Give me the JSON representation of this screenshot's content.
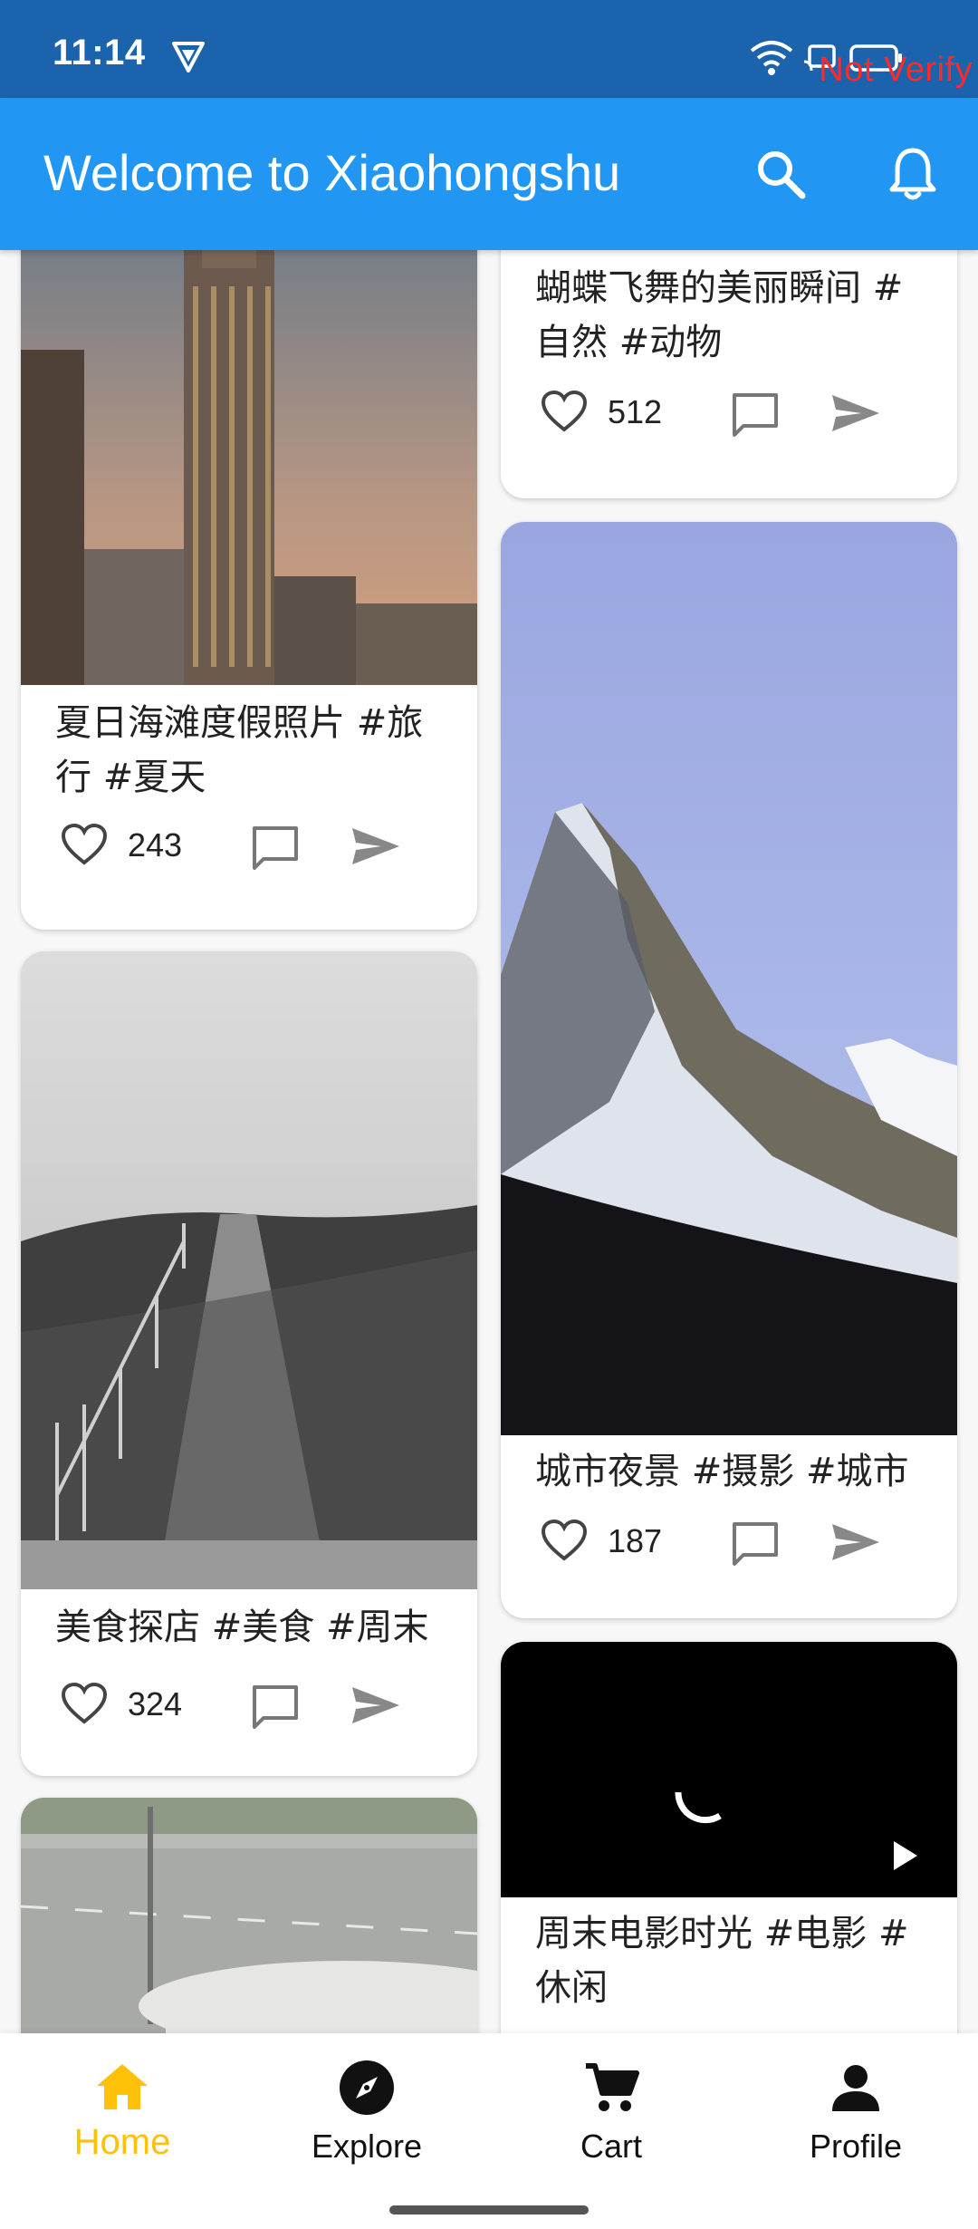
{
  "status": {
    "time": "11:14",
    "warning": "Not Verify"
  },
  "app_bar": {
    "title": "Welcome to Xiaohongshu",
    "search_icon": "search-icon",
    "notifications_icon": "bell-icon"
  },
  "feed": {
    "left": [
      {
        "caption": "夏日海滩度假照片 #旅行 #夏天",
        "likes": "243",
        "image": "city-skyline-photo"
      },
      {
        "caption": "美食探店 #美食 #周末",
        "likes": "324",
        "image": "hill-path-photo"
      },
      {
        "caption": "",
        "likes": "",
        "image": "road-car-photo"
      }
    ],
    "right": [
      {
        "caption": "蝴蝶飞舞的美丽瞬间 #自然 #动物",
        "likes": "512",
        "image": ""
      },
      {
        "caption": "城市夜景 #摄影 #城市",
        "likes": "187",
        "image": "mountain-photo"
      },
      {
        "caption": "周末电影时光 #电影 #休闲",
        "likes": "",
        "image": "video-player"
      }
    ]
  },
  "bottom_nav": {
    "items": [
      {
        "label": "Home",
        "icon": "home-icon",
        "active": true
      },
      {
        "label": "Explore",
        "icon": "compass-icon",
        "active": false
      },
      {
        "label": "Cart",
        "icon": "cart-icon",
        "active": false
      },
      {
        "label": "Profile",
        "icon": "person-icon",
        "active": false
      }
    ]
  },
  "colors": {
    "status_bar": "#1b63ad",
    "app_bar": "#2196f3",
    "active_nav": "#ffc107",
    "warning_text": "#ff2a2a"
  }
}
